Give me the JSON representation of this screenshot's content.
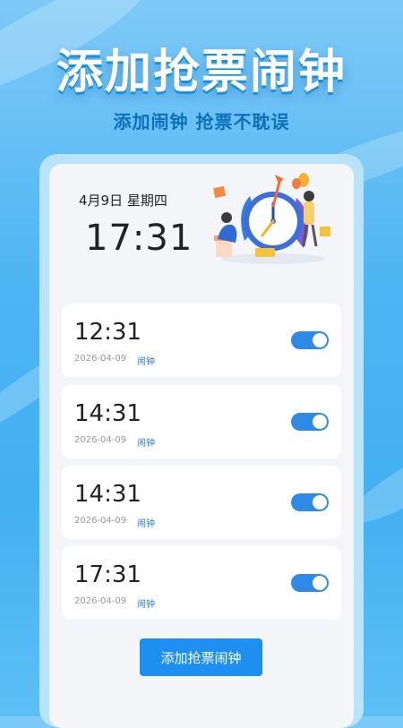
{
  "promo": {
    "headline": "添加抢票闹钟",
    "subhead": "添加闹钟  抢票不耽误"
  },
  "clock": {
    "date": "4月9日 星期四",
    "time": "17:31"
  },
  "alarms": [
    {
      "time": "12:31",
      "date": "2026-04-09",
      "tag": "闹钟",
      "enabled": true
    },
    {
      "time": "14:31",
      "date": "2026-04-09",
      "tag": "闹钟",
      "enabled": true
    },
    {
      "time": "14:31",
      "date": "2026-04-09",
      "tag": "闹钟",
      "enabled": true
    },
    {
      "time": "17:31",
      "date": "2026-04-09",
      "tag": "闹钟",
      "enabled": true
    }
  ],
  "add_button_label": "添加抢票闹钟",
  "colors": {
    "accent": "#2f8ae6",
    "button": "#1e8ff0",
    "headline": "#ffffff",
    "subhead": "#0f6fb8"
  },
  "icons": [
    "alarm-clock-illustration-icon",
    "toggle-switch-icon"
  ]
}
